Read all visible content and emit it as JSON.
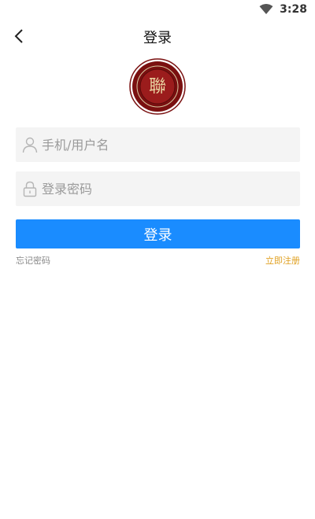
{
  "status_bar": {
    "time": "3:28",
    "wifi_icon": "wifi-icon"
  },
  "nav": {
    "title": "登录",
    "back_icon": "chevron-left-icon"
  },
  "logo": {
    "name": "round-seal-logo-icon",
    "glyph": "聯",
    "colors": {
      "outer": "#7a1010",
      "inner": "#9b1c1c",
      "ring": "#d8c8a0"
    }
  },
  "form": {
    "username": {
      "value": "",
      "placeholder": "手机/用户名",
      "icon": "user-icon"
    },
    "password": {
      "value": "",
      "placeholder": "登录密码",
      "icon": "lock-icon"
    },
    "submit_label": "登录",
    "forgot_label": "忘记密码",
    "register_label": "立即注册"
  },
  "colors": {
    "primary": "#1a8cff",
    "register": "#e0a020",
    "field_bg": "#f4f4f4"
  }
}
